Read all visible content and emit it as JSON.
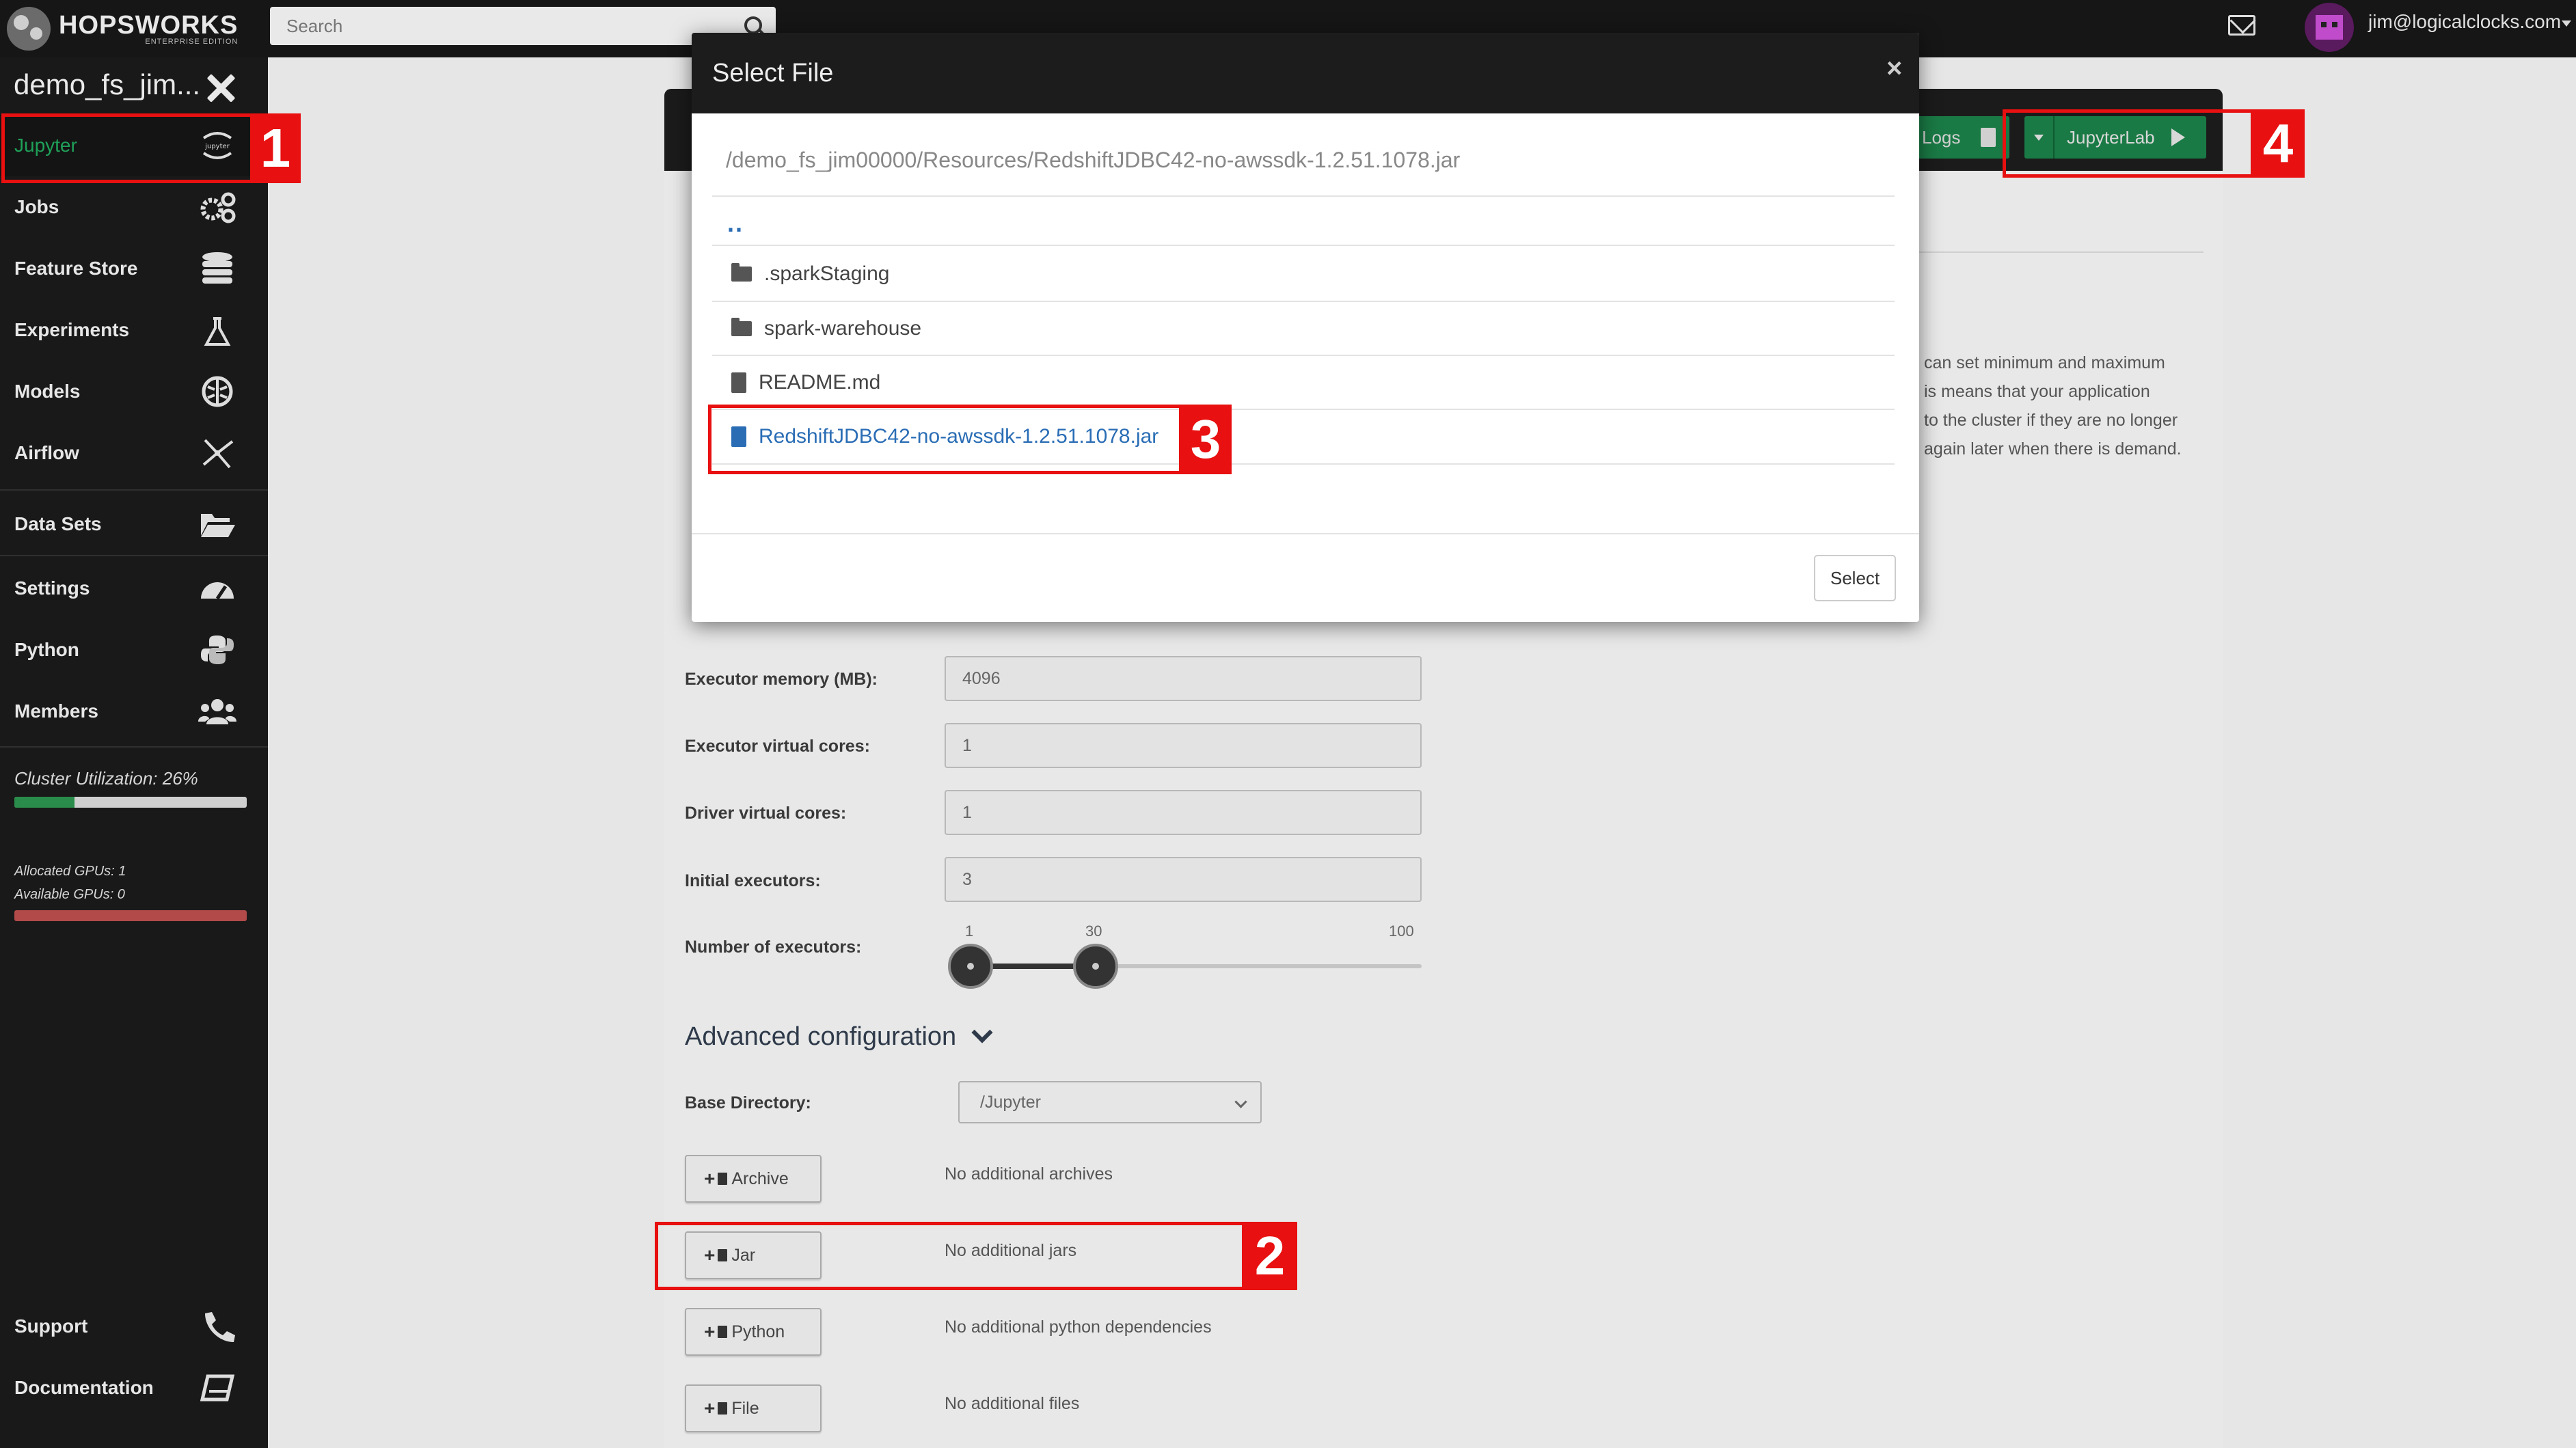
{
  "app": {
    "logo_text": "HOPSWORKS",
    "logo_subtext": "ENTERPRISE EDITION",
    "search_placeholder": "Search",
    "user_email": "jim@logicalclocks.com"
  },
  "sidebar": {
    "project_name": "demo_fs_jim...",
    "items": [
      {
        "label": "Jupyter",
        "icon": "jupyter-icon",
        "active": true
      },
      {
        "label": "Jobs",
        "icon": "gears-icon"
      },
      {
        "label": "Feature Store",
        "icon": "database-icon"
      },
      {
        "label": "Experiments",
        "icon": "flask-icon"
      },
      {
        "label": "Models",
        "icon": "brain-icon"
      },
      {
        "label": "Airflow",
        "icon": "airflow-icon"
      },
      {
        "label": "Data Sets",
        "icon": "folder-open-icon"
      },
      {
        "label": "Settings",
        "icon": "gauge-icon"
      },
      {
        "label": "Python",
        "icon": "python-icon"
      },
      {
        "label": "Members",
        "icon": "users-icon"
      }
    ],
    "cluster_utilization_label": "Cluster Utilization: 26%",
    "cluster_utilization": 0.26,
    "allocated_gpus": "Allocated GPUs: 1",
    "available_gpus": "Available GPUs: 0",
    "footer_items": [
      {
        "label": "Support",
        "icon": "phone-icon"
      },
      {
        "label": "Documentation",
        "icon": "book-icon"
      }
    ]
  },
  "toolbar": {
    "logs_label": "Logs",
    "jupyterlab_label": "JupyterLab"
  },
  "background_text": [
    "can set minimum and maximum",
    "is means that your application",
    "to the cluster if they are no longer",
    "again later when there is demand."
  ],
  "form": {
    "fields": [
      {
        "label": "Executor memory (MB):",
        "value": "4096"
      },
      {
        "label": "Executor virtual cores:",
        "value": "1"
      },
      {
        "label": "Driver virtual cores:",
        "value": "1"
      },
      {
        "label": "Initial executors:",
        "value": "3"
      }
    ],
    "executors_label": "Number of executors:",
    "slider": {
      "min": 1,
      "value": 30,
      "max": 100,
      "tick_min": "1",
      "tick_value": "30",
      "tick_max": "100"
    },
    "advanced_title": "Advanced configuration",
    "base_dir_label": "Base Directory:",
    "base_dir_value": "/Jupyter",
    "dependencies": [
      {
        "button": "Archive",
        "text": "No additional archives"
      },
      {
        "button": "Jar",
        "text": "No additional jars"
      },
      {
        "button": "Python",
        "text": "No additional python dependencies"
      },
      {
        "button": "File",
        "text": "No additional files"
      }
    ]
  },
  "modal": {
    "title": "Select File",
    "close": "×",
    "path": "/demo_fs_jim00000/Resources/RedshiftJDBC42-no-awssdk-1.2.51.1078.jar",
    "parent": "..",
    "files": [
      {
        "name": ".sparkStaging",
        "type": "folder"
      },
      {
        "name": "spark-warehouse",
        "type": "folder"
      },
      {
        "name": "README.md",
        "type": "file"
      },
      {
        "name": "RedshiftJDBC42-no-awssdk-1.2.51.1078.jar",
        "type": "file",
        "selected": true
      }
    ],
    "select_label": "Select"
  },
  "annotations": [
    "1",
    "2",
    "3",
    "4"
  ],
  "colors": {
    "accent_green": "#1fa058",
    "link_blue": "#2a6db5",
    "annotation_red": "#e81010"
  }
}
